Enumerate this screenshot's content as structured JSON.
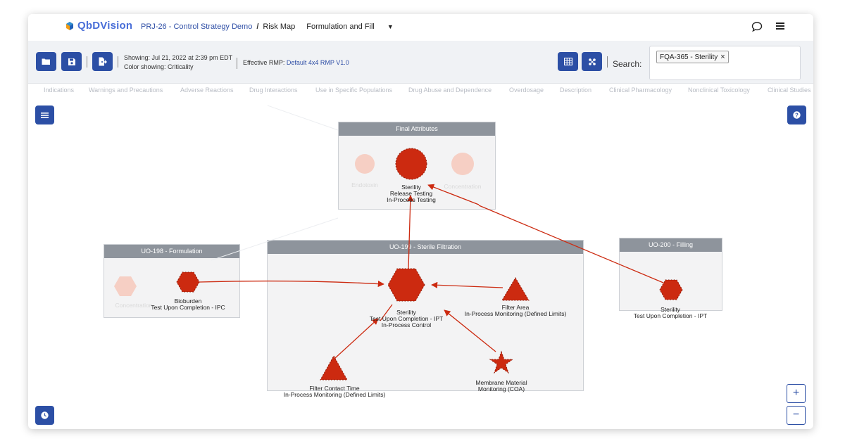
{
  "header": {
    "logo_text": "QbDVision",
    "project": "PRJ-26 - Control Strategy Demo",
    "separator": "/",
    "page": "Risk Map",
    "dropdown_value": "Formulation and Fill"
  },
  "toolbar": {
    "showing": "Showing: Jul 21, 2022 at 2:39 pm EDT",
    "color_showing": "Color showing: Criticality",
    "rmp_label": "Effective RMP:",
    "rmp_value": "Default 4x4 RMP V1.0",
    "search_label": "Search:",
    "search_chip": "FQA-365 - Sterility"
  },
  "faded_tabs": [
    "Indications",
    "Warnings and Precautions",
    "Adverse Reactions",
    "Drug Interactions",
    "Use in Specific Populations",
    "Drug Abuse and Dependence",
    "Overdosage",
    "Description",
    "Clinical Pharmacology",
    "Nonclinical Toxicology",
    "Clinical Studies"
  ],
  "groups": {
    "final_attributes": "Final Attributes",
    "formulation": "UO-198 - Formulation",
    "sterile_filtration": "UO-199 - Sterile Filtration",
    "filling": "UO-200 - Filling"
  },
  "nodes": {
    "endotoxin": "Endotoxin",
    "concentration_fa": "Concentration",
    "sterility_fa_l1": "Sterility",
    "sterility_fa_l2": "Release Testing",
    "sterility_fa_l3": "In-Process Testing",
    "concentration_form": "Concentration",
    "bioburden_l1": "Bioburden",
    "bioburden_l2": "Test Upon Completion - IPC",
    "sterility_sf_l1": "Sterility",
    "sterility_sf_l2": "Test Upon Completion - IPT",
    "sterility_sf_l3": "In-Process Control",
    "filter_area_l1": "Filter Area",
    "filter_area_l2": "In-Process Monitoring (Defined Limits)",
    "filter_contact_l1": "Filter Contact Time",
    "filter_contact_l2": "In-Process Monitoring (Defined Limits)",
    "membrane_l1": "Membrane Material",
    "membrane_l2": "Monitoring (COA)",
    "sterility_fill_l1": "Sterility",
    "sterility_fill_l2": "Test Upon Completion - IPT"
  },
  "zoom": {
    "in": "+",
    "out": "−"
  },
  "colors": {
    "primary": "#2c4fa5",
    "risk_high": "#cc2a10",
    "faded": "#f6cfc4"
  }
}
